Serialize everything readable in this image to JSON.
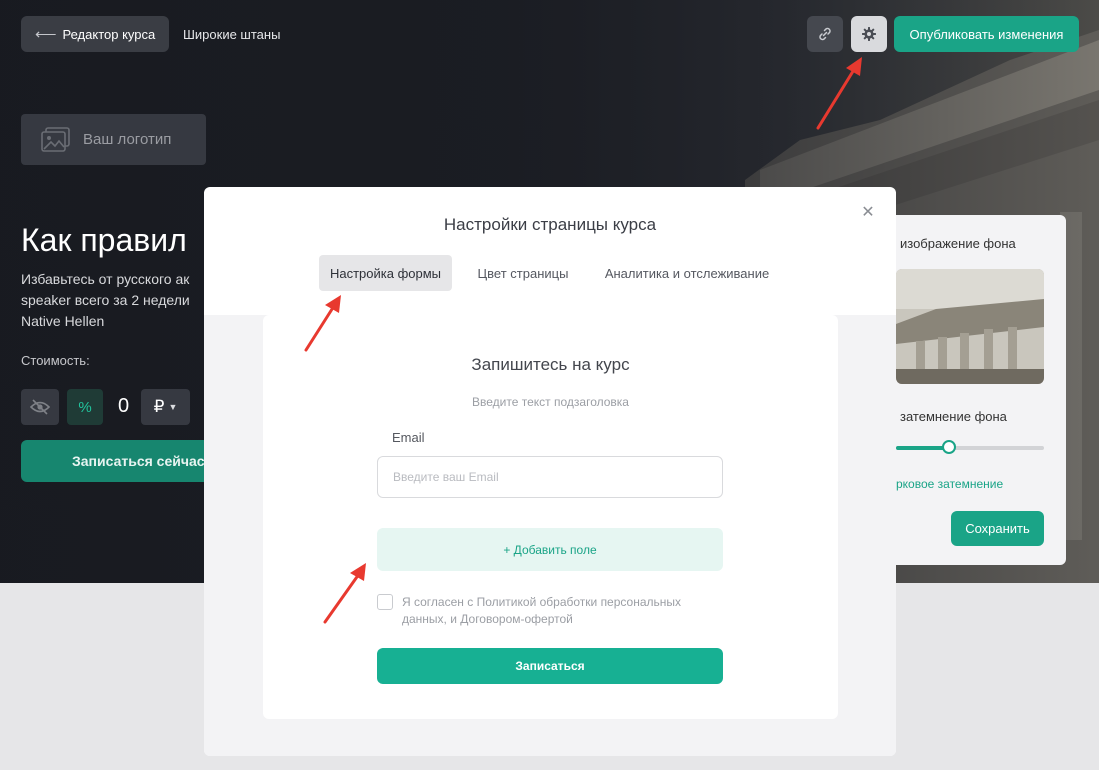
{
  "topbar": {
    "back_label": "Редактор курса",
    "course_name": "Широкие штаны",
    "link_icon": "link-icon",
    "gear_icon": "gear-icon",
    "publish_label": "Опубликовать изменения"
  },
  "page": {
    "logo_label": "Ваш логотип",
    "title": "Как правил",
    "description": "Избавьтесь от русского ак\nspeaker всего за 2 недели \nNative Hellen",
    "price_label": "Стоимость:",
    "price_value": "0",
    "percent_symbol": "%",
    "currency": "₽",
    "enroll_label": "Записаться сейчас"
  },
  "side_panel": {
    "bg_image_label": "изображение фона",
    "dimming_label": "затемнение фона",
    "dimming_level": 0.36,
    "gradient_label": "рковое затемнение",
    "save_label": "Сохранить"
  },
  "modal": {
    "title": "Настройки страницы курса",
    "tabs": [
      {
        "label": "Настройка формы",
        "active": true
      },
      {
        "label": "Цвет страницы",
        "active": false
      },
      {
        "label": "Аналитика и отслеживание",
        "active": false
      }
    ],
    "form": {
      "title": "Запишитесь на курс",
      "subtitle": "Введите текст подзаголовка",
      "email_label": "Email",
      "email_placeholder": "Введите ваш Email",
      "add_field_label": "+ Добавить поле",
      "consent_text": "Я согласен с Политикой обработки персональных данных, и Договором-офертой",
      "consent_checked": false,
      "submit_label": "Записаться"
    }
  },
  "colors": {
    "accent": "#1aa487",
    "arrow": "#e8392f"
  }
}
